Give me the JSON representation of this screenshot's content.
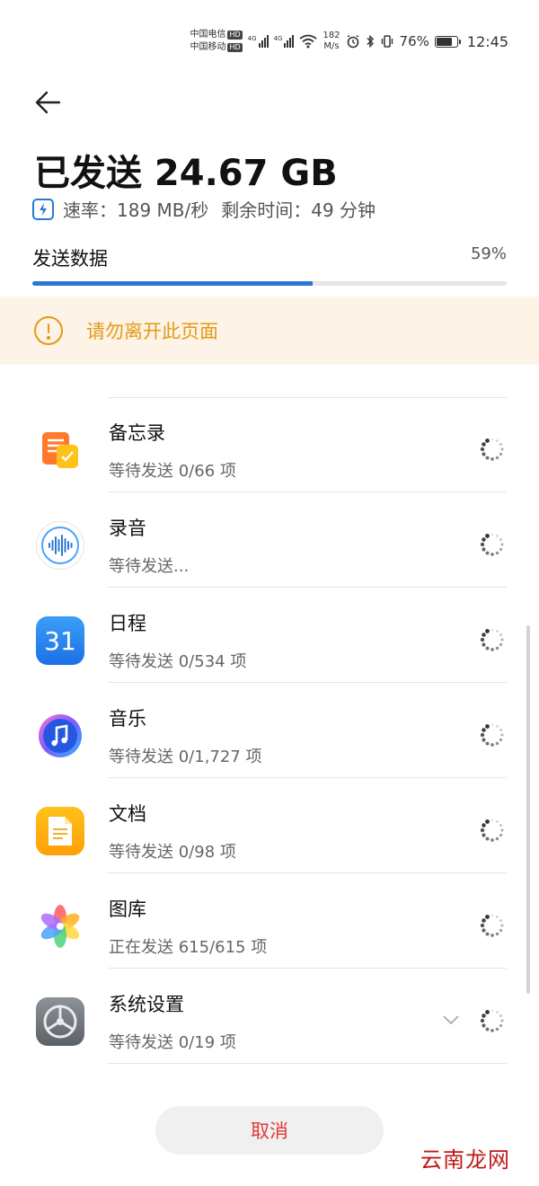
{
  "status_bar": {
    "carrier1": "中国电信",
    "carrier2": "中国移动",
    "hd": "HD",
    "net1": "4G",
    "net2": "4G",
    "speed_value": "182",
    "speed_unit": "M/s",
    "battery_percent": "76%",
    "battery_level": 0.76,
    "time": "12:45"
  },
  "header": {
    "title": "已发送 24.67 GB",
    "rate": "速率：189 MB/秒",
    "remaining": "剩余时间：49 分钟"
  },
  "progress": {
    "label": "发送数据",
    "percent_text": "59%",
    "value": 0.59,
    "color": "#2b78d4"
  },
  "warning": {
    "text": "请勿离开此页面",
    "color": "#e39a16"
  },
  "items": [
    {
      "name": "备忘录",
      "status": "等待发送 0/66 项",
      "icon": "notepad-icon"
    },
    {
      "name": "录音",
      "status": "等待发送...",
      "icon": "recorder-icon"
    },
    {
      "name": "日程",
      "status": "等待发送 0/534 项",
      "icon": "calendar-icon",
      "icon_text": "31"
    },
    {
      "name": "音乐",
      "status": "等待发送 0/1,727 项",
      "icon": "music-icon"
    },
    {
      "name": "文档",
      "status": "等待发送 0/98 项",
      "icon": "document-icon"
    },
    {
      "name": "图库",
      "status": "正在发送 615/615 项",
      "icon": "gallery-icon"
    },
    {
      "name": "系统设置",
      "status": "等待发送 0/19 项",
      "icon": "settings-icon"
    }
  ],
  "cancel_label": "取消",
  "watermark": "云南龙网"
}
